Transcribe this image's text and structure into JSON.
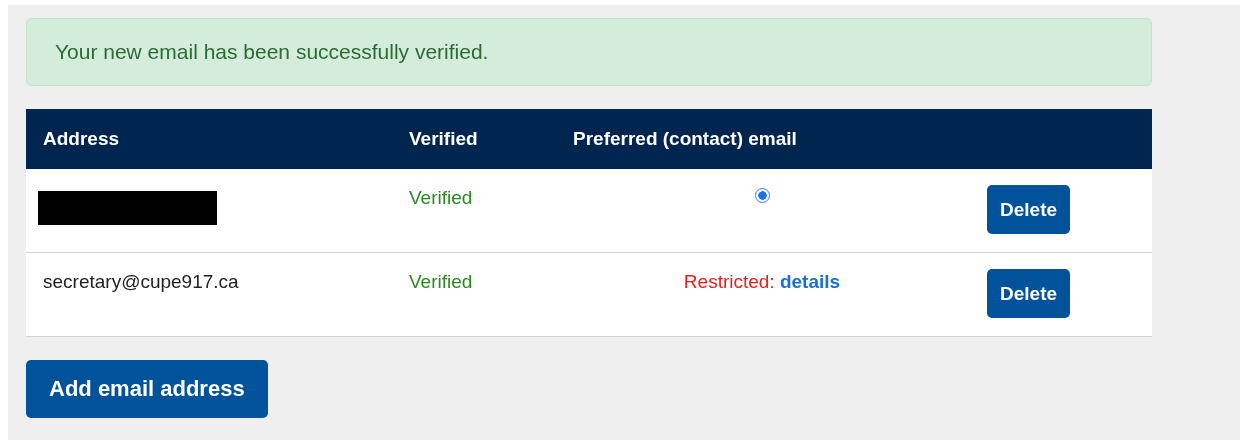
{
  "alert": {
    "message": "Your new email has been successfully verified."
  },
  "table": {
    "columns": [
      "Address",
      "Verified",
      "Preferred (contact) email"
    ],
    "rows": [
      {
        "address": {
          "kind": "redacted"
        },
        "verified": "Verified",
        "preferred": {
          "kind": "radio",
          "selected": true
        },
        "action": "Delete"
      },
      {
        "address": {
          "kind": "text",
          "text": "secretary@cupe917.ca"
        },
        "verified": "Verified",
        "preferred": {
          "kind": "restricted",
          "label": "Restricted:",
          "link": "details"
        },
        "action": "Delete"
      }
    ]
  },
  "add_button": "Add email address"
}
